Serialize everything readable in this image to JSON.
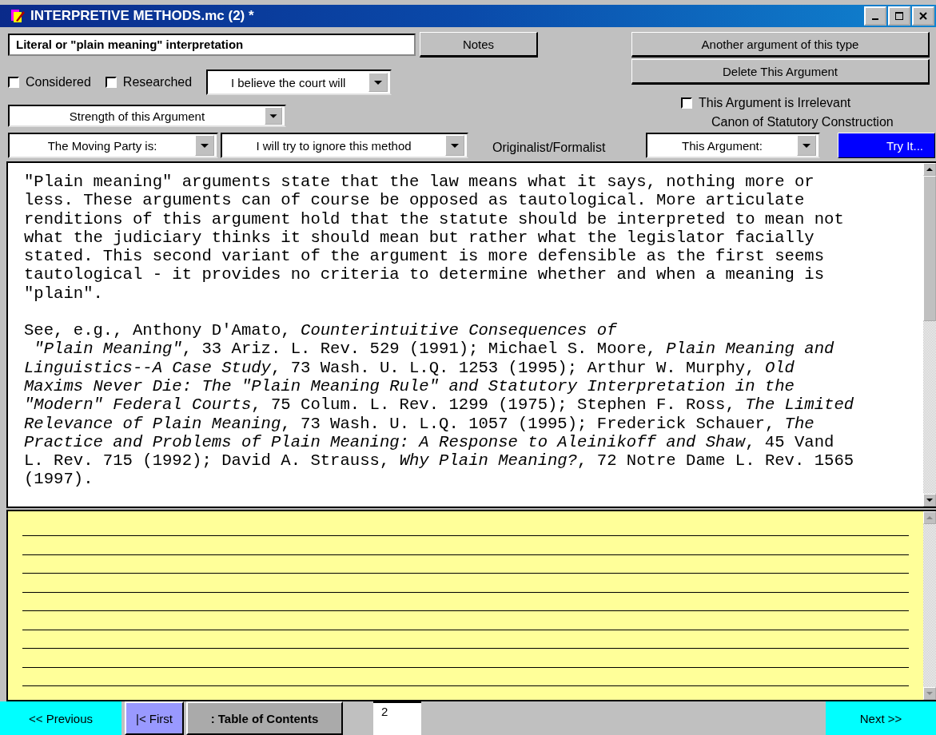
{
  "window": {
    "title": "INTERPRETIVE METHODS.mc (2) *"
  },
  "argument_title": "Literal or \"plain meaning\" interpretation",
  "notes_button": "Notes",
  "checkboxes": [
    {
      "label": "Considered",
      "checked": false
    },
    {
      "label": "Researched",
      "checked": false
    }
  ],
  "court_dropdown": "I believe the court will",
  "strength_dropdown": "Strength of this Argument",
  "another_button": "Another argument of this type",
  "delete_button": "Delete This Argument",
  "irrelevant": {
    "label": "This Argument is Irrelevant",
    "checked": false
  },
  "canon_label": "Canon of Statutory Construction",
  "moving_party_dropdown": "The Moving Party is:",
  "ignore_dropdown": "I will try to ignore this method",
  "school_label": "Originalist/Formalist",
  "this_argument_dropdown": "This Argument:",
  "try_button": "Try It...",
  "body_paragraphs": [
    "\"Plain meaning\" arguments state that the law means what it says, nothing more or\nless. These arguments can of course be opposed as tautological. More articulate\nrenditions of this argument hold that the statute should be interpreted to mean not\nwhat the judiciary thinks it should mean but rather what the legislator facially\nstated. This second variant of the argument is more defensible as the first seems\ntautological - it provides no criteria to determine whether and when a meaning is\n\"plain\".",
    "See, e.g., Anthony D'Amato, *Counterintuitive Consequences of*\n *\"Plain Meaning\"*, 33 Ariz. L. Rev. 529 (1991); Michael S. Moore, *Plain Meaning and*\n*Linguistics--A Case Study*, 73 Wash. U. L.Q. 1253 (1995); Arthur W. Murphy, *Old*\n*Maxims Never Die: The \"Plain Meaning Rule\" and Statutory Interpretation in the*\n*\"Modern\" Federal Courts*, 75 Colum. L. Rev. 1299 (1975); Stephen F. Ross, *The Limited*\n*Relevance of Plain Meaning*, 73 Wash. U. L.Q. 1057 (1995); Frederick Schauer, *The*\n*Practice and Problems of Plain Meaning: A Response to Aleinikoff and Shaw*, 45 Vand\nL. Rev. 715 (1992); David A. Strauss, *Why Plain Meaning?*, 72 Notre Dame L. Rev. 1565\n(1997)."
  ],
  "nav": {
    "previous": "<< Previous",
    "first": "|< First",
    "toc": ": Table of Contents",
    "page": "2",
    "next": "Next >>"
  }
}
